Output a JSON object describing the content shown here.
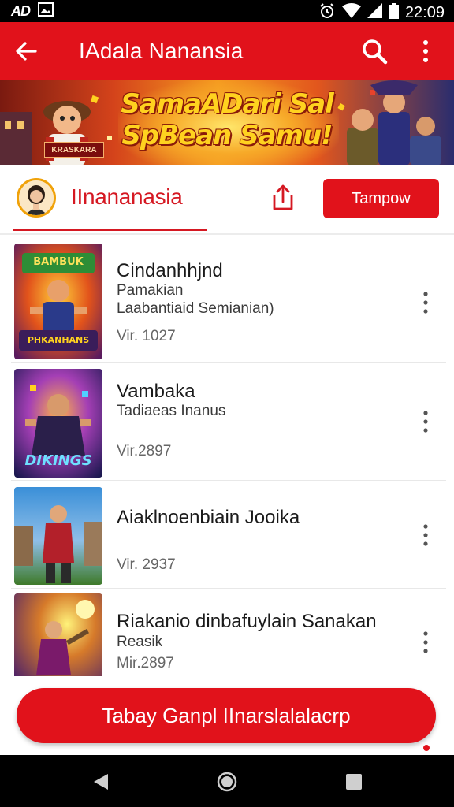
{
  "status_bar": {
    "left_label": "AD",
    "time": "22:09",
    "icons": [
      "gallery-icon",
      "alarm-icon",
      "wifi-icon",
      "signal-icon",
      "battery-icon"
    ]
  },
  "app_bar": {
    "title": "IAdala Nanansia",
    "icons": [
      "back-arrow-icon",
      "search-icon",
      "more-vertical-icon"
    ]
  },
  "banner": {
    "headline_line1": "SamaADari Sal",
    "headline_line2": "SpBean Samu!",
    "tag": "KRASKARA"
  },
  "channel": {
    "name": "IInananasia",
    "follow_label": "Tampow"
  },
  "items": [
    {
      "title": "Cindanhhjnd",
      "subtitle": "Pamakian",
      "subtitle2": "Laabantiaid Semianian)",
      "meta": "Vir. 1027",
      "thumb_top": "BAMBUK",
      "thumb_bottom": "PHKANHANS"
    },
    {
      "title": "Vambaka",
      "subtitle": "Tadiaeas Inanus",
      "subtitle2": "",
      "meta": "Vir.2897",
      "thumb_top": "",
      "thumb_bottom": "DIKINGS"
    },
    {
      "title": "Aiaklnoenbiain Jooika",
      "subtitle": "",
      "subtitle2": "",
      "meta": "Vir. 2937",
      "thumb_top": "",
      "thumb_bottom": ""
    },
    {
      "title": "Riakanio dinbafuylain Sanakan",
      "subtitle": "Reasik",
      "subtitle2": "",
      "meta": "Mir.2897",
      "thumb_top": "",
      "thumb_bottom": ""
    }
  ],
  "cta": {
    "label": "Tabay Ganpl IInarslalalacrp"
  },
  "colors": {
    "brand_red": "#e1121b",
    "accent_red_text": "#d51822"
  }
}
